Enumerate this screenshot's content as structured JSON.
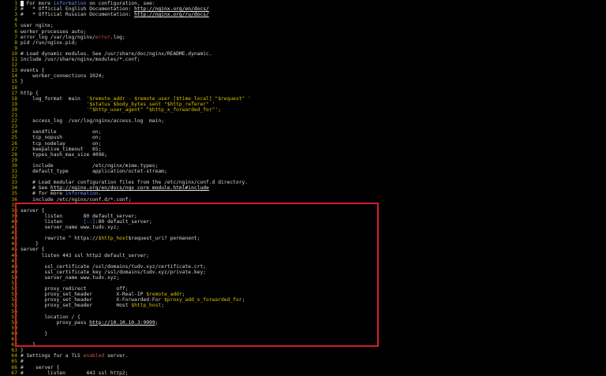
{
  "editor": {
    "lines": [
      {
        "n": "1",
        "tokens": [
          {
            "t": " ",
            "c": "cursor"
          },
          {
            "t": " For more "
          },
          {
            "t": "information",
            "c": "dim"
          },
          {
            "t": " on configuration, see:"
          }
        ]
      },
      {
        "n": "2",
        "tokens": [
          {
            "t": "#   * Official English Documentation: "
          },
          {
            "t": "http://nginx.org/en/docs/",
            "c": "link"
          }
        ]
      },
      {
        "n": "3",
        "tokens": [
          {
            "t": "#   * Official Russian Documentation: "
          },
          {
            "t": "http://nginx.org/ru/docs/",
            "c": "link"
          }
        ]
      },
      {
        "n": "4",
        "tokens": []
      },
      {
        "n": "5",
        "tokens": [
          {
            "t": "user nginx;"
          }
        ]
      },
      {
        "n": "6",
        "tokens": [
          {
            "t": "worker_processes auto;"
          }
        ]
      },
      {
        "n": "7",
        "tokens": [
          {
            "t": "error_log /var/log/nginx/"
          },
          {
            "t": "error",
            "c": "keyword"
          },
          {
            "t": ".log;"
          }
        ]
      },
      {
        "n": "8",
        "tokens": [
          {
            "t": "pid /run/nginx.pid;"
          }
        ]
      },
      {
        "n": "9",
        "tokens": []
      },
      {
        "n": "10",
        "tokens": [
          {
            "t": "# Load dynamic modules. See /usr/share/doc/nginx/README.dynamic."
          }
        ]
      },
      {
        "n": "11",
        "tokens": [
          {
            "t": "include /usr/share/nginx/modules/*.conf;"
          }
        ]
      },
      {
        "n": "12",
        "tokens": []
      },
      {
        "n": "13",
        "tokens": [
          {
            "t": "events {"
          }
        ]
      },
      {
        "n": "14",
        "tokens": [
          {
            "t": "    worker_connections 1024;"
          }
        ]
      },
      {
        "n": "15",
        "tokens": [
          {
            "t": "}"
          }
        ]
      },
      {
        "n": "16",
        "tokens": []
      },
      {
        "n": "17",
        "tokens": [
          {
            "t": "http {"
          }
        ]
      },
      {
        "n": "18",
        "tokens": [
          {
            "t": "    log_format  main  "
          },
          {
            "t": "'$remote_addr - $remote_user [$time_local] \"$request\" '",
            "c": "string"
          }
        ]
      },
      {
        "n": "19",
        "tokens": [
          {
            "t": "                      "
          },
          {
            "t": "'$status $body_bytes_sent \"$http_referer\" '",
            "c": "string"
          }
        ]
      },
      {
        "n": "20",
        "tokens": [
          {
            "t": "                      "
          },
          {
            "t": "'\"$http_user_agent\" \"$http_x_forwarded_for\"';",
            "c": "string"
          }
        ]
      },
      {
        "n": "21",
        "tokens": []
      },
      {
        "n": "22",
        "tokens": [
          {
            "t": "    access_log  /var/log/nginx/access.log  main;"
          }
        ]
      },
      {
        "n": "23",
        "tokens": []
      },
      {
        "n": "24",
        "tokens": [
          {
            "t": "    sendfile            on;"
          }
        ]
      },
      {
        "n": "25",
        "tokens": [
          {
            "t": "    tcp_nopush          on;"
          }
        ]
      },
      {
        "n": "26",
        "tokens": [
          {
            "t": "    tcp_nodelay         on;"
          }
        ]
      },
      {
        "n": "27",
        "tokens": [
          {
            "t": "    keepalive_timeout   65;"
          }
        ]
      },
      {
        "n": "28",
        "tokens": [
          {
            "t": "    types_hash_max_size 4096;"
          }
        ]
      },
      {
        "n": "29",
        "tokens": []
      },
      {
        "n": "30",
        "tokens": [
          {
            "t": "    include             /etc/nginx/mime.types;"
          }
        ]
      },
      {
        "n": "31",
        "tokens": [
          {
            "t": "    default_type        application/octet-stream;"
          }
        ]
      },
      {
        "n": "32",
        "tokens": []
      },
      {
        "n": "33",
        "tokens": [
          {
            "t": "    # Load modular configuration files from the /etc/nginx/conf.d directory."
          }
        ]
      },
      {
        "n": "34",
        "tokens": [
          {
            "t": "    # See "
          },
          {
            "t": "http://nginx.org/en/docs/ngx_core_module.html#include",
            "c": "link"
          }
        ]
      },
      {
        "n": "35",
        "tokens": [
          {
            "t": "    # for more "
          },
          {
            "t": "information",
            "c": "dim"
          },
          {
            "t": "."
          }
        ]
      },
      {
        "n": "36",
        "tokens": [
          {
            "t": "    include /etc/nginx/conf.d/*.conf;"
          }
        ]
      },
      {
        "n": "37",
        "tokens": []
      },
      {
        "n": "38",
        "tokens": [
          {
            "t": "server {"
          }
        ]
      },
      {
        "n": "39",
        "tokens": [
          {
            "t": "        listen       80 default_server;"
          }
        ]
      },
      {
        "n": "40",
        "tokens": [
          {
            "t": "        listen       "
          },
          {
            "t": "[::]",
            "c": "dim"
          },
          {
            "t": ":80 default_server;"
          }
        ]
      },
      {
        "n": "41",
        "tokens": [
          {
            "t": "        server_name www.tudv.xyz;"
          }
        ]
      },
      {
        "n": "42",
        "tokens": []
      },
      {
        "n": "43",
        "tokens": [
          {
            "t": "        rewrite ^ https://"
          },
          {
            "t": "$http_host",
            "c": "var"
          },
          {
            "t": "$request_uri? permanent;"
          }
        ]
      },
      {
        "n": "44",
        "tokens": [
          {
            "t": "     }"
          }
        ]
      },
      {
        "n": "45",
        "tokens": [
          {
            "t": "server {"
          }
        ]
      },
      {
        "n": "46",
        "tokens": [
          {
            "t": "       listen 443 ssl http2 default_server;"
          }
        ]
      },
      {
        "n": "47",
        "tokens": []
      },
      {
        "n": "48",
        "tokens": [
          {
            "t": "        ssl_certificate /ssl/domains/tudv.xyz/certificate.crt;"
          }
        ]
      },
      {
        "n": "49",
        "tokens": [
          {
            "t": "        ssl_certificate_key /ssl/domains/tudv.xyz/private.key;"
          }
        ]
      },
      {
        "n": "50",
        "tokens": [
          {
            "t": "        server_name www.tudv.xyz;"
          }
        ]
      },
      {
        "n": "51",
        "tokens": []
      },
      {
        "n": "52",
        "tokens": [
          {
            "t": "        proxy_redirect          off;"
          }
        ]
      },
      {
        "n": "53",
        "tokens": [
          {
            "t": "        proxy_set_header        X-Real-IP "
          },
          {
            "t": "$remote_addr",
            "c": "var"
          },
          {
            "t": ";"
          }
        ]
      },
      {
        "n": "54",
        "tokens": [
          {
            "t": "        proxy_set_header        X-Forwarded-For "
          },
          {
            "t": "$proxy_add_x_forwarded_for",
            "c": "var"
          },
          {
            "t": ";"
          }
        ]
      },
      {
        "n": "55",
        "tokens": [
          {
            "t": "        proxy_set_header        Host "
          },
          {
            "t": "$http_host",
            "c": "var"
          },
          {
            "t": ";"
          }
        ]
      },
      {
        "n": "56",
        "tokens": []
      },
      {
        "n": "57",
        "tokens": [
          {
            "t": "        location / {"
          }
        ]
      },
      {
        "n": "58",
        "tokens": [
          {
            "t": "            proxy_pass "
          },
          {
            "t": "http://10.10.10.3:9999",
            "c": "link"
          },
          {
            "t": ";"
          }
        ]
      },
      {
        "n": "59",
        "tokens": []
      },
      {
        "n": "60",
        "tokens": [
          {
            "t": "        }"
          }
        ]
      },
      {
        "n": "61",
        "tokens": []
      },
      {
        "n": "62",
        "tokens": [
          {
            "t": "    }"
          }
        ]
      },
      {
        "n": "63",
        "tokens": [
          {
            "t": "}"
          }
        ]
      },
      {
        "n": "64",
        "tokens": [
          {
            "t": "# Settings for a TLS "
          },
          {
            "t": "enabled",
            "c": "keyword"
          },
          {
            "t": " server."
          }
        ]
      },
      {
        "n": "65",
        "tokens": [
          {
            "t": "#"
          }
        ]
      },
      {
        "n": "66",
        "tokens": [
          {
            "t": "#    server {"
          }
        ]
      },
      {
        "n": "67",
        "tokens": [
          {
            "t": "#        listen       443 ssl http2;"
          }
        ]
      }
    ]
  },
  "colors": {
    "background": "#000000",
    "line_numbers": "#c9b100",
    "text": "#d6d6d6",
    "highlight_box": "#d11e2e"
  }
}
